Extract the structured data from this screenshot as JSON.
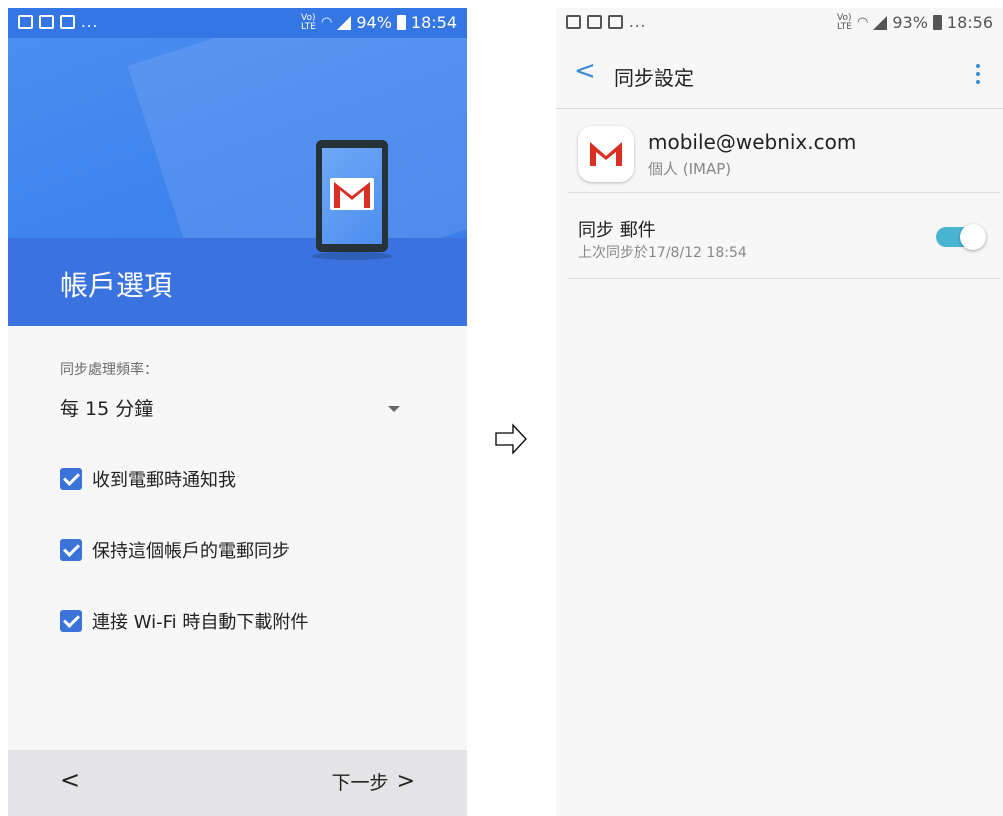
{
  "left_screen": {
    "status_bar": {
      "more": "...",
      "battery": "94%",
      "time": "18:54"
    },
    "hero": {
      "title": "帳戶選項"
    },
    "sync_frequency": {
      "label": "同步處理頻率：",
      "value": "每 15 分鐘"
    },
    "options": [
      {
        "label": "收到電郵時通知我",
        "checked": true
      },
      {
        "label": "保持這個帳戶的電郵同步",
        "checked": true
      },
      {
        "label": "連接 Wi-Fi 時自動下載附件",
        "checked": true
      }
    ],
    "footer": {
      "back": "<",
      "next": "下一步",
      "next_chevron": ">"
    }
  },
  "transition_arrow": "⇨",
  "right_screen": {
    "status_bar": {
      "more": "...",
      "battery": "93%",
      "time": "18:56"
    },
    "app_bar": {
      "back": "<",
      "title": "同步設定"
    },
    "account": {
      "email": "mobile@webnix.com",
      "type": "個人 (IMAP)"
    },
    "sync_mail": {
      "title": "同步 郵件",
      "last_sync": "上次同步於17/8/12 18:54",
      "enabled": true
    }
  },
  "colors": {
    "left_header": "#3476e3",
    "checkbox": "#3b73d9",
    "toggle": "#49b5d3",
    "accent": "#3a8bd3",
    "gmail_red": "#d93025"
  }
}
